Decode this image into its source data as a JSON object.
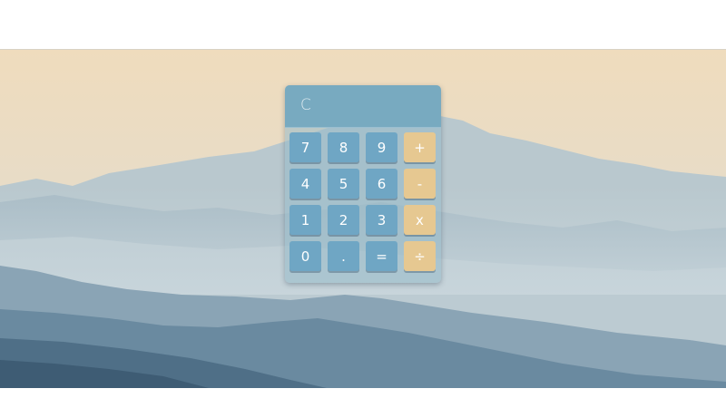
{
  "calculator": {
    "display": "C",
    "colors": {
      "display_bg": "#78aac0",
      "number_key": "#6fa6c4",
      "operator_key": "#e6c891",
      "key_text": "#ffffff"
    },
    "keys": [
      {
        "label": "7",
        "kind": "num"
      },
      {
        "label": "8",
        "kind": "num"
      },
      {
        "label": "9",
        "kind": "num"
      },
      {
        "label": "+",
        "kind": "op"
      },
      {
        "label": "4",
        "kind": "num"
      },
      {
        "label": "5",
        "kind": "num"
      },
      {
        "label": "6",
        "kind": "num"
      },
      {
        "label": "-",
        "kind": "op"
      },
      {
        "label": "1",
        "kind": "num"
      },
      {
        "label": "2",
        "kind": "num"
      },
      {
        "label": "3",
        "kind": "num"
      },
      {
        "label": "x",
        "kind": "op"
      },
      {
        "label": "0",
        "kind": "num"
      },
      {
        "label": ".",
        "kind": "num"
      },
      {
        "label": "=",
        "kind": "num"
      },
      {
        "label": "÷",
        "kind": "op"
      }
    ]
  }
}
